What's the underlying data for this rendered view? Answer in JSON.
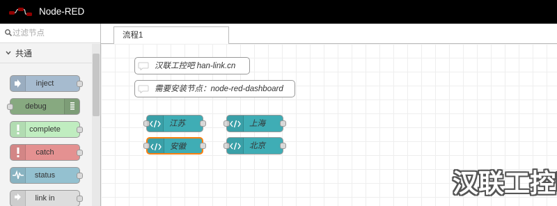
{
  "header": {
    "title": "Node-RED",
    "logo_icon": "node-red-logo-icon"
  },
  "palette": {
    "search_placeholder": "过滤节点",
    "category": "共通",
    "nodes": [
      {
        "label": "inject",
        "color": "#a6bbcf",
        "icon": "arrow-in-icon"
      },
      {
        "label": "debug",
        "color": "#87a980",
        "icon": "bars-icon"
      },
      {
        "label": "complete",
        "color": "#c0edc0",
        "icon": "exclamation-icon"
      },
      {
        "label": "catch",
        "color": "#e49191",
        "icon": "exclamation-icon"
      },
      {
        "label": "status",
        "color": "#94c1d0",
        "icon": "pulse-icon"
      },
      {
        "label": "link in",
        "color": "#dddddd",
        "icon": "link-in-icon"
      }
    ]
  },
  "workspace": {
    "tab": "流程1",
    "comments": [
      {
        "text": "汉联工控吧 han-link.cn"
      },
      {
        "text": "需要安装节点：node-red-dashboard"
      }
    ],
    "functions": [
      {
        "label": "江苏"
      },
      {
        "label": "上海"
      },
      {
        "label": "安徽"
      },
      {
        "label": "北京"
      }
    ]
  },
  "watermark": "汉联工控吧"
}
